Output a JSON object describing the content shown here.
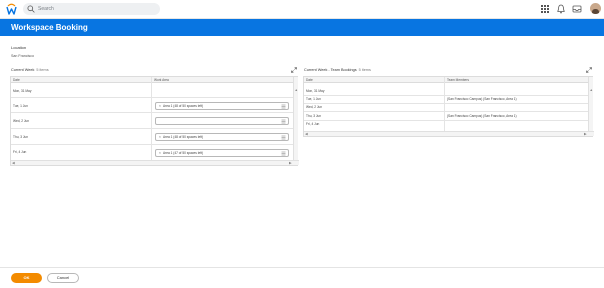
{
  "topbar": {
    "search_placeholder": "Search",
    "icons": [
      "workday-logo",
      "search-icon",
      "grid-icon",
      "bell-icon",
      "inbox-icon",
      "avatar"
    ]
  },
  "header": {
    "title": "Workspace Booking"
  },
  "location": {
    "label": "Location",
    "value": "San Francisco"
  },
  "current_week": {
    "title": "Current Week",
    "count": "5 items",
    "columns": [
      "Date",
      "Work Area"
    ],
    "rows": [
      {
        "date": "Mon, 31 May",
        "area": ""
      },
      {
        "date": "Tue, 1 Jun",
        "area": "Area 1 (48 of 50 spaces left)"
      },
      {
        "date": "Wed, 2 Jun",
        "area": ""
      },
      {
        "date": "Thu, 3 Jun",
        "area": "Area 1 (48 of 50 spaces left)"
      },
      {
        "date": "Fri, 4 Jun",
        "area": "Area 1 (47 of 50 spaces left)"
      }
    ]
  },
  "team_bookings": {
    "title": "Current Week - Team Bookings",
    "count": "5 items",
    "columns": [
      "Date",
      "Team Members"
    ],
    "rows": [
      {
        "date": "Mon, 31 May",
        "members": ""
      },
      {
        "date": "Tue, 1 Jun",
        "members": "(San Francisco Campus) (San Francisco, Area 1)"
      },
      {
        "date": "Wed, 2 Jun",
        "members": ""
      },
      {
        "date": "Thu, 3 Jun",
        "members": "(San Francisco Campus) (San Francisco, Area 1)"
      },
      {
        "date": "Fri, 4 Jun",
        "members": ""
      }
    ]
  },
  "footer": {
    "ok_label": "OK",
    "cancel_label": "Cancel"
  },
  "colors": {
    "brand_blue": "#0875e1",
    "ok_orange": "#f38b00"
  }
}
